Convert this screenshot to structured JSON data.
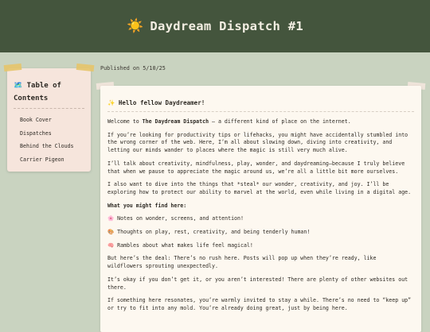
{
  "header": {
    "icon": "sun-icon",
    "sun": "☀️",
    "title": "Daydream Dispatch #1"
  },
  "sidebar": {
    "title": "🗺️ Table of Contents",
    "items": [
      "Book Cover",
      "Dispatches",
      "Behind the Clouds",
      "Carrier Pigeon"
    ]
  },
  "post": {
    "published": "Published on 5/10/25",
    "greeting": "✨ Hello fellow Daydreamer!",
    "welcome_pre": "Welcome to ",
    "welcome_bold": "The Daydream Dispatch",
    "welcome_post": " – a different kind of place on the internet.",
    "p1": "If you’re looking for productivity tips or lifehacks, you might have accidentally stumbled into the wrong corner of the web. Here, I’m all about slowing down, diving into creativity, and letting our minds wander to places where the magic is still very much alive.",
    "p2": "I’ll talk about creativity, mindfulness, play, wonder, and daydreaming—because I truly believe that when we pause to appreciate the magic around us, we’re all a little bit more ourselves.",
    "p3": "I also want to dive into the things that *steal* our wonder, creativity, and joy. I’ll be exploring how to protect our ability to marvel at the world, even while living in a digital age.",
    "find_heading": "What you might find here:",
    "find_items": [
      "🌸 Notes on wonder, screens, and attention!",
      "🎨 Thoughts on play, rest, creativity, and being tenderly human!",
      "🧠 Rambles about what makes life feel magical!"
    ],
    "p4": "But here’s the deal: There’s no rush here. Posts will pop up when they’re ready, like wildflowers sprouting unexpectedly.",
    "p5": "It’s okay if you don’t get it, or you aren’t interested! There are plenty of other websites out there.",
    "p6": "If something here resonates, you’re warmly invited to stay a while. There’s no need to “keep up” or try to fit into any mold. You’re already doing great, just by being here."
  },
  "colors": {
    "header_bg": "#44553d",
    "page_bg": "#c9d3c0",
    "sidebar_bg": "#f6e5dc",
    "card_bg": "#fdf8f0",
    "tape": "#e6c46a"
  }
}
